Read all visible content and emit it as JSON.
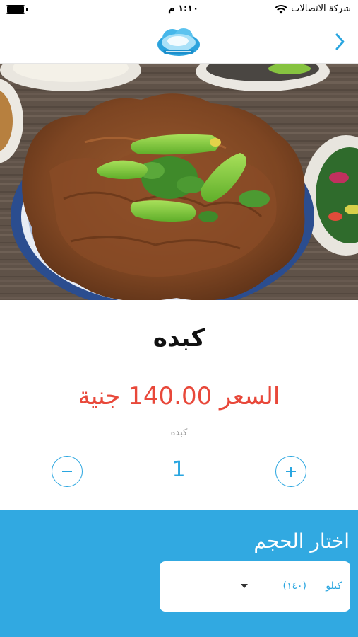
{
  "status_bar": {
    "carrier": "شركة الاتصالات",
    "time": "١:١٠ م"
  },
  "icons": {
    "back": "chevron-right-icon",
    "wifi": "wifi-icon",
    "battery": "battery-icon",
    "minus": "minus-icon",
    "plus": "plus-icon",
    "dropdown": "caret-down-icon"
  },
  "product": {
    "name": "كبده",
    "price_line": "السعر 140.00 جنية",
    "description": "كبده"
  },
  "quantity": {
    "value": "1"
  },
  "size_selector": {
    "heading": "اختار الحجم",
    "selected_option": {
      "name": "كيلو",
      "count": "(١٤٠)"
    }
  },
  "colors": {
    "accent": "#2aa6e0",
    "panel": "#31a9e1",
    "price": "#e8483a"
  }
}
